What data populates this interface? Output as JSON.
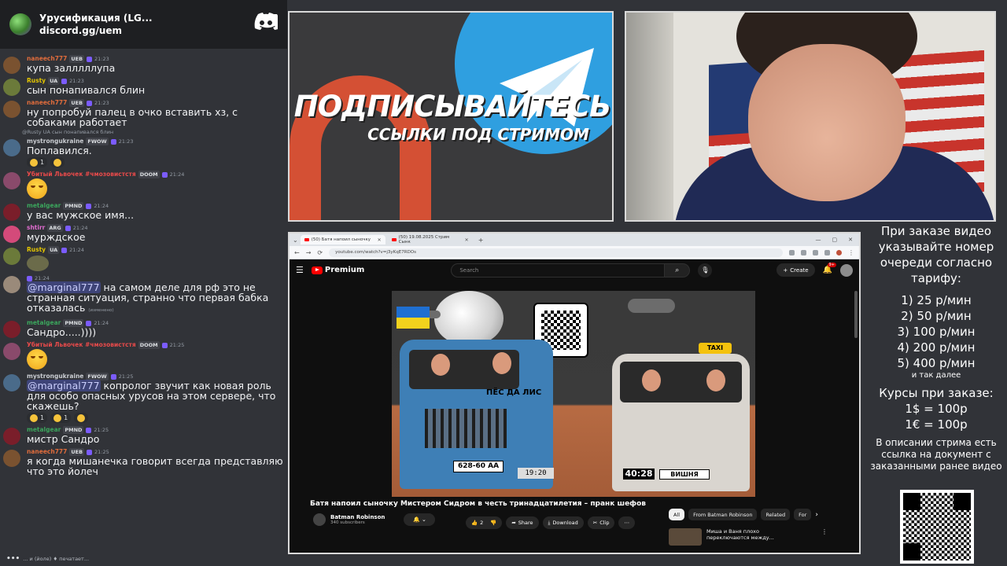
{
  "discord": {
    "server_name": "Урусификация (LG...",
    "invite": "discord.gg/uem",
    "typing": "... и (йоле) ♦ печатает..."
  },
  "messages": [
    {
      "user": "naneech777",
      "color": "#e06c3c",
      "tag": "UEB",
      "time": "21:23",
      "text": "купа залллллупа",
      "avatar": "#7a5230"
    },
    {
      "user": "Rusty",
      "color": "#e3c400",
      "tag": "UA",
      "time": "21:23",
      "text": "сын понапивался блин",
      "avatar": "#6b7a3a"
    },
    {
      "user": "naneech777",
      "color": "#e06c3c",
      "tag": "UEB",
      "time": "21:23",
      "text": "ну попробуй палец в очко вставить хз, с собаками работает",
      "avatar": "#7a5230"
    },
    {
      "reply": "@Rusty UA сын понапивался блин",
      "user": "mystrongukraine",
      "color": "#c9ccd1",
      "tag": "FWOW",
      "time": "21:23",
      "text": "Поплавился.",
      "avatar": "#4a6b8a",
      "reactions": [
        {
          "label": "1"
        },
        {
          "label": ""
        }
      ]
    },
    {
      "user": "Убитый Львочек #чмозовистстя",
      "color": "#e84a4a",
      "tag": "DOOM",
      "time": "21:24",
      "emoji": "crying-laugh",
      "avatar": "#8a4a6b"
    },
    {
      "user": "metalgear",
      "color": "#3ba55c",
      "tag": "PMND",
      "time": "21:24",
      "text": "у вас мужское имя...",
      "avatar": "#7a1e2a"
    },
    {
      "user": "shtirr",
      "color": "#e06ccf",
      "tag": "ARG",
      "time": "21:24",
      "text": "мурждское",
      "avatar": "#d44a7a"
    },
    {
      "user": "Rusty",
      "color": "#e3c400",
      "tag": "UA",
      "time": "21:24",
      "sticker": true,
      "avatar": "#6b7a3a"
    },
    {
      "user": "",
      "color": "#c9ccd1",
      "tag": "",
      "time": "21:24",
      "text_mention": "@marginal777",
      "text": " на самом деле для рф это не странная ситуация, странно что первая бабка отказалась",
      "edited": "(изменено)",
      "avatar": "#9a8a7a"
    },
    {
      "user": "metalgear",
      "color": "#3ba55c",
      "tag": "PMND",
      "time": "21:24",
      "text": "Сандро.....))))",
      "avatar": "#7a1e2a"
    },
    {
      "user": "Убитый Львочек #чмозовистстя",
      "color": "#e84a4a",
      "tag": "DOOM",
      "time": "21:25",
      "emoji": "crying-laugh",
      "avatar": "#8a4a6b"
    },
    {
      "user": "mystrongukraine",
      "color": "#c9ccd1",
      "tag": "FWOW",
      "time": "21:25",
      "text_mention": "@marginal777",
      "text": " копролог звучит как новая роль для особо опасных урусов на этом сервере, что скажешь?",
      "avatar": "#4a6b8a",
      "reactions": [
        {
          "label": "1"
        },
        {
          "label": "1"
        },
        {
          "label": ""
        }
      ]
    },
    {
      "user": "metalgear",
      "color": "#3ba55c",
      "tag": "PMND",
      "time": "21:25",
      "text": "мистр Сандро",
      "avatar": "#7a1e2a"
    },
    {
      "user": "naneech777",
      "color": "#e06c3c",
      "tag": "UEB",
      "time": "21:25",
      "text": "я когда мишанечка говорит всегда представляю что это йолеч",
      "avatar": "#7a5230"
    }
  ],
  "banner": {
    "title": "ПОДПИСЫВАЙТЕСЬ",
    "subtitle": "ССЫЛКИ ПОД СТРИМОМ"
  },
  "browser": {
    "tab1": "(50) Батя напоил сыночку",
    "tab2": "(50) 19.08.2025 Стрим Сынк",
    "url": "youtube.com/watch?v=j3yKqE7RDOs",
    "brand": "Premium",
    "search_placeholder": "Search",
    "create_label": "Create",
    "notif_count": "9+",
    "video_title": "Батя напоил сыночку Мистером Сидром в честь тринадцатилетия – пранк шефов",
    "channel_name": "Batman Robinson",
    "channel_subs": "340 subscribers",
    "like_count": "2",
    "share_label": "Share",
    "download_label": "Download",
    "clip_label": "Clip",
    "chips": [
      "All",
      "From Batman Robinson",
      "Related",
      "For"
    ],
    "rec_title": "Миша и Ваня плохо",
    "rec_title2": "переключаются между...",
    "thumb": {
      "plate_blue": "628-60 AA",
      "van_sign": "ПЁС ДА ЛИС",
      "clock_blue": "19:20",
      "taxi": "TAXI",
      "clock_white": "40:28",
      "plate_white": "ВИШНЯ"
    }
  },
  "info": {
    "heading": "При заказе видео указывайте номер очереди согласно тарифу:",
    "tariffs": [
      "1) 25 р/мин",
      "2) 50 р/мин",
      "3) 100 р/мин",
      "4) 200 р/мин",
      "5) 400 р/мин"
    ],
    "etc": "и так далее",
    "courses_h": "Курсы при заказе:",
    "usd": "1$ = 100р",
    "eur": "1€ = 100р",
    "desc": "В описании стрима есть ссылка на документ с заказанными ранее видео"
  }
}
